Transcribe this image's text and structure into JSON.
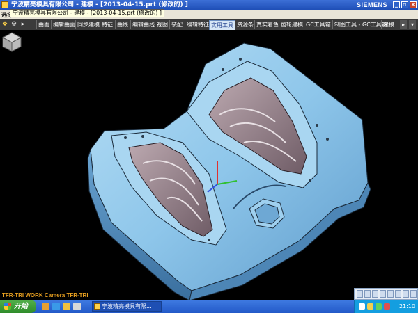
{
  "window": {
    "title": "宁波精亮模具有限公司 - 建模 - [2013-04-15.prt (修改的) ]",
    "brand": "SIEMENS",
    "buttons": {
      "minimize": "_",
      "restore": "▫",
      "close": "×"
    }
  },
  "tooltip": {
    "text": "宁波精亮模具有限公司 - 建模 - [2013-04-15.prt (修改的) ]"
  },
  "toolbar_row": {
    "label": "选择条"
  },
  "menubar": {
    "items": [
      "曲面",
      "编辑曲面",
      "同步建模",
      "特征",
      "曲线",
      "编辑曲线",
      "视图",
      "装配",
      "编辑特征",
      "实用工具",
      "资源条",
      "真实着色",
      "齿轮建模",
      "GC工具箱",
      "制图工具 - GC工具箱",
      "建模"
    ],
    "active_item": "实用工具",
    "scroll_right": "▸",
    "overflow": "▾"
  },
  "viewport": {
    "label": "TFR-TRI WORK Camera TFR-TRI",
    "colors": {
      "background": "#000000",
      "part": "#8fc9ec",
      "part_dark": "#4d86b6",
      "cavity": "#9b8790",
      "edge": "#1a2a3a"
    }
  },
  "taskbar": {
    "start_label": "开始",
    "task_label": "宁波精亮模具有限...",
    "clock": "21:10",
    "colors": {
      "bar": "#2a62d0",
      "start": "#3f9e3a",
      "tray": "#149ee0"
    }
  }
}
